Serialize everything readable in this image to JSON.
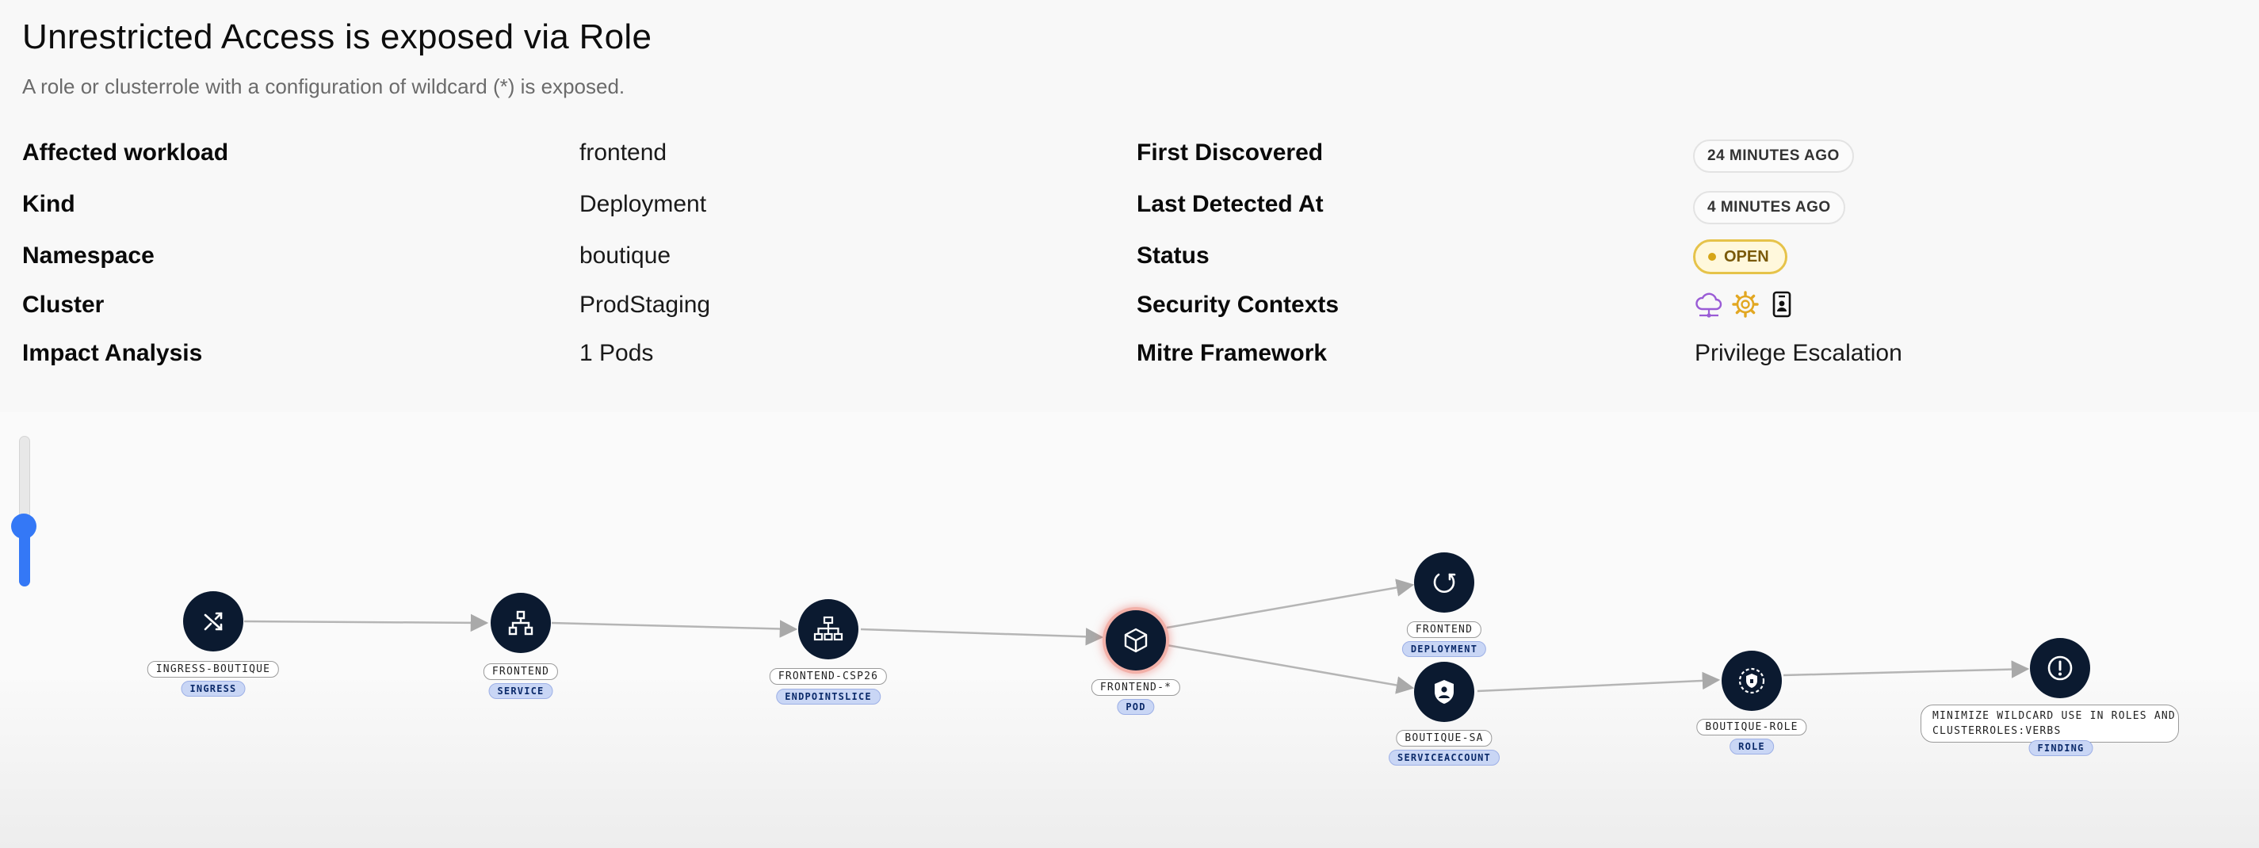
{
  "header": {
    "title": "Unrestricted Access is exposed via Role",
    "subtitle": "A role or clusterrole with a configuration of wildcard (*) is exposed."
  },
  "details": {
    "left": [
      {
        "label": "Affected workload",
        "value": "frontend"
      },
      {
        "label": "Kind",
        "value": "Deployment"
      },
      {
        "label": "Namespace",
        "value": "boutique"
      },
      {
        "label": "Cluster",
        "value": "ProdStaging"
      },
      {
        "label": "Impact Analysis",
        "value": "1 Pods"
      }
    ],
    "right": {
      "first_discovered_label": "First Discovered",
      "first_discovered_value": "24 MINUTES AGO",
      "last_detected_label": "Last Detected At",
      "last_detected_value": "4 MINUTES AGO",
      "status_label": "Status",
      "status_value": "OPEN",
      "security_contexts_label": "Security Contexts",
      "security_contexts_icons": [
        "cloud-network-icon",
        "gear-icon",
        "id-badge-icon"
      ],
      "mitre_label": "Mitre Framework",
      "mitre_value": "Privilege Escalation"
    }
  },
  "colors": {
    "node_fill": "#0b1a30",
    "type_badge": "#c9d6f5",
    "status_border": "#e6c34a",
    "zoom_accent": "#3478f6",
    "pod_glow": "#e65a50"
  },
  "graph": {
    "nodes": [
      {
        "id": "ingress",
        "name": "INGRESS-BOUTIQUE",
        "type": "INGRESS",
        "icon": "shuffle-icon"
      },
      {
        "id": "service",
        "name": "FRONTEND",
        "type": "SERVICE",
        "icon": "hierarchy-icon"
      },
      {
        "id": "endpointslice",
        "name": "FRONTEND-CSP26",
        "type": "ENDPOINTSLICE",
        "icon": "network-tree-icon"
      },
      {
        "id": "pod",
        "name": "FRONTEND-*",
        "type": "POD",
        "icon": "cube-icon"
      },
      {
        "id": "deployment",
        "name": "FRONTEND",
        "type": "DEPLOYMENT",
        "icon": "refresh-circle-icon"
      },
      {
        "id": "serviceaccount",
        "name": "BOUTIQUE-SA",
        "type": "SERVICEACCOUNT",
        "icon": "shield-user-icon"
      },
      {
        "id": "role",
        "name": "BOUTIQUE-ROLE",
        "type": "ROLE",
        "icon": "shield-dashed-icon"
      },
      {
        "id": "finding",
        "name": "MINIMIZE WILDCARD USE IN ROLES AND\nCLUSTERROLES:VERBS",
        "type": "FINDING",
        "icon": "alert-circle-icon"
      }
    ],
    "edges": [
      [
        "ingress",
        "service"
      ],
      [
        "service",
        "endpointslice"
      ],
      [
        "endpointslice",
        "pod"
      ],
      [
        "pod",
        "deployment"
      ],
      [
        "pod",
        "serviceaccount"
      ],
      [
        "serviceaccount",
        "role"
      ],
      [
        "role",
        "finding"
      ]
    ]
  },
  "zoom": {
    "level": 0.4
  }
}
